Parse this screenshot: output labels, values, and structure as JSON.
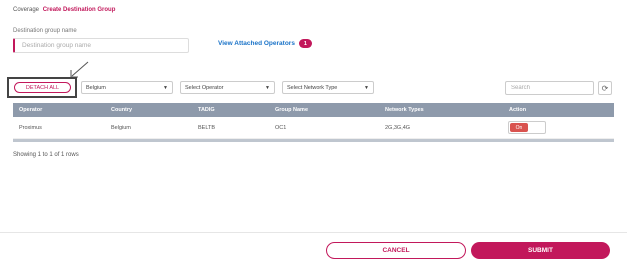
{
  "breadcrumb": {
    "parent": "Coverage",
    "current": "Create Destination Group"
  },
  "form": {
    "name_label": "Destination group name",
    "name_placeholder": "Destination group name",
    "name_value": ""
  },
  "attached": {
    "link_label": "View Attached Operators",
    "count": "1"
  },
  "toolbar": {
    "detach_label": "DETACH ALL",
    "country_value": "Belgium",
    "operator_value": "Select Operator",
    "network_value": "Select Network Type",
    "search_placeholder": "Search"
  },
  "table": {
    "headers": [
      "Operator",
      "Country",
      "TADIG",
      "Group Name",
      "Network Types",
      "Action"
    ],
    "rows": [
      {
        "operator": "Proximus",
        "country": "Belgium",
        "tadig": "BELTB",
        "group_name": "OC1",
        "network_types": "2G,3G,4G",
        "action": "On"
      }
    ]
  },
  "pagination": {
    "summary": "Showing 1 to 1 of 1 rows"
  },
  "footer": {
    "cancel_label": "CANCEL",
    "submit_label": "SUBMIT"
  },
  "colors": {
    "accent": "#c2185b",
    "link": "#1a73c8",
    "table_header": "#8e9aab",
    "toggle_on": "#d9534f"
  }
}
